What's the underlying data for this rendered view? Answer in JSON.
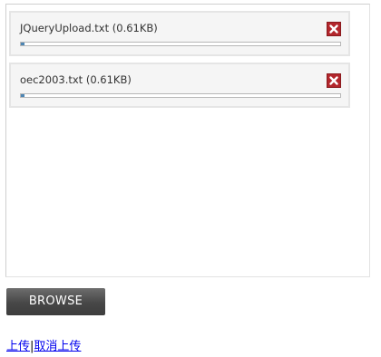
{
  "queue": {
    "items": [
      {
        "file_label": "JQueryUpload.txt (0.61KB)",
        "progress": 0.01,
        "cancel_icon": "close-icon"
      },
      {
        "file_label": "oec2003.txt (0.61KB)",
        "progress": 0.01,
        "cancel_icon": "close-icon"
      }
    ]
  },
  "browse": {
    "label": "BROWSE"
  },
  "links": {
    "upload": "上传",
    "separator": "|",
    "cancel_upload": "取消上传"
  },
  "colors": {
    "cancel_button": "#b3262c",
    "progress_fill": "#4e86b3",
    "browse_button": "#474747"
  }
}
